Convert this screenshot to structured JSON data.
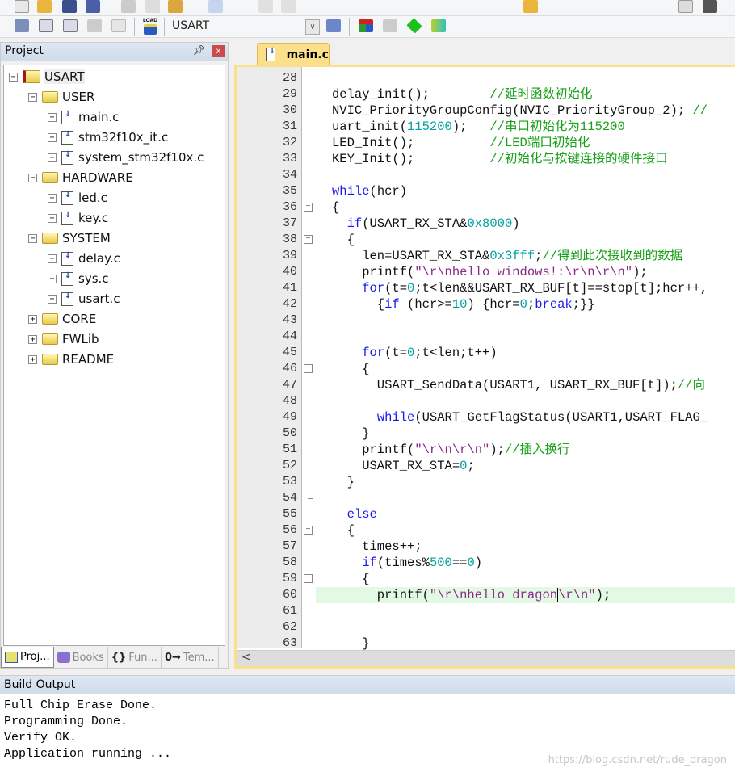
{
  "toolbar": {
    "target_name": "USART",
    "load_label": "LOAD"
  },
  "project_panel": {
    "title": "Project",
    "tree": [
      {
        "label": "USART",
        "level": 0,
        "icon": "project-root-icon",
        "expander": "minus"
      },
      {
        "label": "USER",
        "level": 1,
        "icon": "folder-open-icon",
        "expander": "minus"
      },
      {
        "label": "main.c",
        "level": 2,
        "icon": "c-file-icon",
        "expander": "plus"
      },
      {
        "label": "stm32f10x_it.c",
        "level": 2,
        "icon": "c-file-icon",
        "expander": "plus"
      },
      {
        "label": "system_stm32f10x.c",
        "level": 2,
        "icon": "c-file-icon",
        "expander": "plus"
      },
      {
        "label": "HARDWARE",
        "level": 1,
        "icon": "folder-open-icon",
        "expander": "minus"
      },
      {
        "label": "led.c",
        "level": 2,
        "icon": "c-file-icon",
        "expander": "plus"
      },
      {
        "label": "key.c",
        "level": 2,
        "icon": "c-file-icon",
        "expander": "plus"
      },
      {
        "label": "SYSTEM",
        "level": 1,
        "icon": "folder-open-icon",
        "expander": "minus"
      },
      {
        "label": "delay.c",
        "level": 2,
        "icon": "c-file-icon",
        "expander": "plus"
      },
      {
        "label": "sys.c",
        "level": 2,
        "icon": "c-file-icon",
        "expander": "plus"
      },
      {
        "label": "usart.c",
        "level": 2,
        "icon": "c-file-icon",
        "expander": "plus"
      },
      {
        "label": "CORE",
        "level": 1,
        "icon": "folder-closed-icon",
        "expander": "plus"
      },
      {
        "label": "FWLib",
        "level": 1,
        "icon": "folder-closed-icon",
        "expander": "plus"
      },
      {
        "label": "README",
        "level": 1,
        "icon": "folder-closed-icon",
        "expander": "plus"
      }
    ],
    "tabs": [
      {
        "label": "Proj...",
        "icon": "project-icon",
        "active": true
      },
      {
        "label": "Books",
        "icon": "books-icon",
        "active": false
      },
      {
        "label": "Fun...",
        "icon": "functions-icon",
        "glyph": "{}",
        "active": false
      },
      {
        "label": "Tem...",
        "icon": "templates-icon",
        "glyph": "0→",
        "active": false
      }
    ]
  },
  "editor": {
    "tab_label": "main.c",
    "highlight_color": "#e4f9e4",
    "lines": [
      {
        "n": "28",
        "segments": []
      },
      {
        "n": "29",
        "segments": [
          {
            "t": "delay_init();        ",
            "c": "p"
          },
          {
            "t": "//延时函数初始化",
            "c": "c"
          }
        ]
      },
      {
        "n": "30",
        "segments": [
          {
            "t": "NVIC_PriorityGroupConfig(NVIC_PriorityGroup_2); ",
            "c": "p"
          },
          {
            "t": "//",
            "c": "c"
          }
        ]
      },
      {
        "n": "31",
        "segments": [
          {
            "t": "uart_init(",
            "c": "p"
          },
          {
            "t": "115200",
            "c": "n"
          },
          {
            "t": ");   ",
            "c": "p"
          },
          {
            "t": "//串口初始化为115200",
            "c": "c"
          }
        ]
      },
      {
        "n": "32",
        "segments": [
          {
            "t": "LED_Init();          ",
            "c": "p"
          },
          {
            "t": "//LED端口初始化",
            "c": "c"
          }
        ]
      },
      {
        "n": "33",
        "segments": [
          {
            "t": "KEY_Init();          ",
            "c": "p"
          },
          {
            "t": "//初始化与按键连接的硬件接口",
            "c": "c"
          }
        ]
      },
      {
        "n": "34",
        "segments": []
      },
      {
        "n": "35",
        "segments": [
          {
            "t": "while",
            "c": "k"
          },
          {
            "t": "(hcr)",
            "c": "p"
          }
        ]
      },
      {
        "n": "36",
        "fold": "open",
        "segments": [
          {
            "t": "{",
            "c": "p"
          }
        ]
      },
      {
        "n": "37",
        "segments": [
          {
            "t": "  ",
            "c": "p"
          },
          {
            "t": "if",
            "c": "k"
          },
          {
            "t": "(USART_RX_STA&",
            "c": "p"
          },
          {
            "t": "0x8000",
            "c": "n"
          },
          {
            "t": ")",
            "c": "p"
          }
        ]
      },
      {
        "n": "38",
        "fold": "open",
        "segments": [
          {
            "t": "  {",
            "c": "p"
          }
        ]
      },
      {
        "n": "39",
        "segments": [
          {
            "t": "    len=USART_RX_STA&",
            "c": "p"
          },
          {
            "t": "0x3fff",
            "c": "n"
          },
          {
            "t": ";",
            "c": "p"
          },
          {
            "t": "//得到此次接收到的数据",
            "c": "c"
          }
        ]
      },
      {
        "n": "40",
        "segments": [
          {
            "t": "    printf(",
            "c": "p"
          },
          {
            "t": "\"\\r\\nhello windows!:\\r\\n\\r\\n\"",
            "c": "s"
          },
          {
            "t": ");",
            "c": "p"
          }
        ]
      },
      {
        "n": "41",
        "segments": [
          {
            "t": "    ",
            "c": "p"
          },
          {
            "t": "for",
            "c": "k"
          },
          {
            "t": "(t=",
            "c": "p"
          },
          {
            "t": "0",
            "c": "n"
          },
          {
            "t": ";t<len&&USART_RX_BUF[t]==stop[t];hcr++,",
            "c": "p"
          }
        ]
      },
      {
        "n": "42",
        "segments": [
          {
            "t": "      {",
            "c": "p"
          },
          {
            "t": "if",
            "c": "k"
          },
          {
            "t": " (hcr>=",
            "c": "p"
          },
          {
            "t": "10",
            "c": "n"
          },
          {
            "t": ") {hcr=",
            "c": "p"
          },
          {
            "t": "0",
            "c": "n"
          },
          {
            "t": ";",
            "c": "p"
          },
          {
            "t": "break",
            "c": "k"
          },
          {
            "t": ";}}",
            "c": "p"
          }
        ]
      },
      {
        "n": "43",
        "segments": []
      },
      {
        "n": "44",
        "segments": []
      },
      {
        "n": "45",
        "segments": [
          {
            "t": "    ",
            "c": "p"
          },
          {
            "t": "for",
            "c": "k"
          },
          {
            "t": "(t=",
            "c": "p"
          },
          {
            "t": "0",
            "c": "n"
          },
          {
            "t": ";t<len;t++)",
            "c": "p"
          }
        ]
      },
      {
        "n": "46",
        "fold": "open",
        "segments": [
          {
            "t": "    {",
            "c": "p"
          }
        ]
      },
      {
        "n": "47",
        "segments": [
          {
            "t": "      USART_SendData(USART1, USART_RX_BUF[t]);",
            "c": "p"
          },
          {
            "t": "//向",
            "c": "c"
          }
        ]
      },
      {
        "n": "48",
        "segments": []
      },
      {
        "n": "49",
        "segments": [
          {
            "t": "      ",
            "c": "p"
          },
          {
            "t": "while",
            "c": "k"
          },
          {
            "t": "(USART_GetFlagStatus(USART1,USART_FLAG_",
            "c": "p"
          }
        ]
      },
      {
        "n": "50",
        "fold": "end",
        "segments": [
          {
            "t": "    }",
            "c": "p"
          }
        ]
      },
      {
        "n": "51",
        "segments": [
          {
            "t": "    printf(",
            "c": "p"
          },
          {
            "t": "\"\\r\\n\\r\\n\"",
            "c": "s"
          },
          {
            "t": ");",
            "c": "p"
          },
          {
            "t": "//插入换行",
            "c": "c"
          }
        ]
      },
      {
        "n": "52",
        "segments": [
          {
            "t": "    USART_RX_STA=",
            "c": "p"
          },
          {
            "t": "0",
            "c": "n"
          },
          {
            "t": ";",
            "c": "p"
          }
        ]
      },
      {
        "n": "53",
        "segments": [
          {
            "t": "  }",
            "c": "p"
          }
        ]
      },
      {
        "n": "54",
        "fold": "end",
        "segments": []
      },
      {
        "n": "55",
        "segments": [
          {
            "t": "  ",
            "c": "p"
          },
          {
            "t": "else",
            "c": "k"
          }
        ]
      },
      {
        "n": "56",
        "fold": "open",
        "segments": [
          {
            "t": "  {",
            "c": "p"
          }
        ]
      },
      {
        "n": "57",
        "segments": [
          {
            "t": "    times++;",
            "c": "p"
          }
        ]
      },
      {
        "n": "58",
        "segments": [
          {
            "t": "    ",
            "c": "p"
          },
          {
            "t": "if",
            "c": "k"
          },
          {
            "t": "(times%",
            "c": "p"
          },
          {
            "t": "500",
            "c": "n"
          },
          {
            "t": "==",
            "c": "p"
          },
          {
            "t": "0",
            "c": "n"
          },
          {
            "t": ")",
            "c": "p"
          }
        ]
      },
      {
        "n": "59",
        "fold": "open",
        "segments": [
          {
            "t": "    {",
            "c": "p"
          }
        ]
      },
      {
        "n": "60",
        "highlight": true,
        "segments": [
          {
            "t": "      printf(",
            "c": "p"
          },
          {
            "t": "\"\\r\\nhello dragon",
            "c": "s"
          },
          {
            "t": "\\r\\n\"",
            "c": "s",
            "caret_before": true
          },
          {
            "t": ");",
            "c": "p"
          }
        ]
      },
      {
        "n": "61",
        "segments": []
      },
      {
        "n": "62",
        "segments": []
      },
      {
        "n": "63",
        "segments": [
          {
            "t": "    }",
            "c": "p"
          }
        ]
      }
    ]
  },
  "build_output": {
    "title": "Build Output",
    "lines": [
      "Full Chip Erase Done.",
      "Programming Done.",
      "Verify OK.",
      "Application running ..."
    ]
  },
  "watermark": "https://blog.csdn.net/rude_dragon"
}
